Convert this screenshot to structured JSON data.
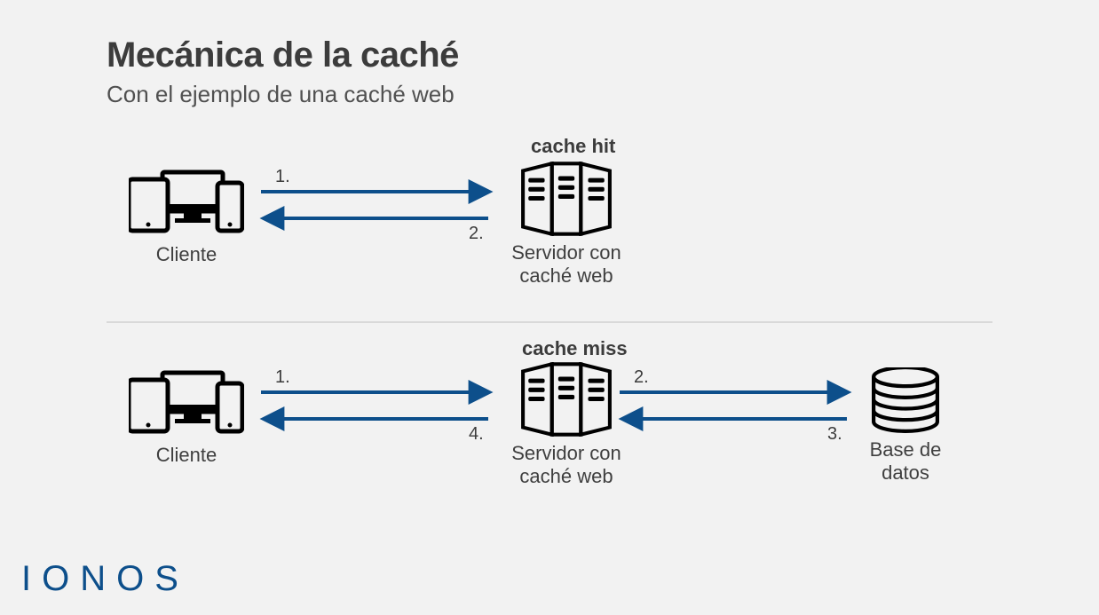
{
  "title": "Mecánica de la caché",
  "subtitle": "Con el ejemplo de una caché web",
  "sections": {
    "hit": {
      "label": "cache hit"
    },
    "miss": {
      "label": "cache miss"
    }
  },
  "nodes": {
    "client": "Cliente",
    "server": "Servidor con caché web",
    "db": "Base de datos"
  },
  "steps": {
    "hit": {
      "req": "1.",
      "res": "2."
    },
    "miss": {
      "req": "1.",
      "fwd": "2.",
      "back": "3.",
      "res": "4."
    }
  },
  "brand": "IONOS"
}
